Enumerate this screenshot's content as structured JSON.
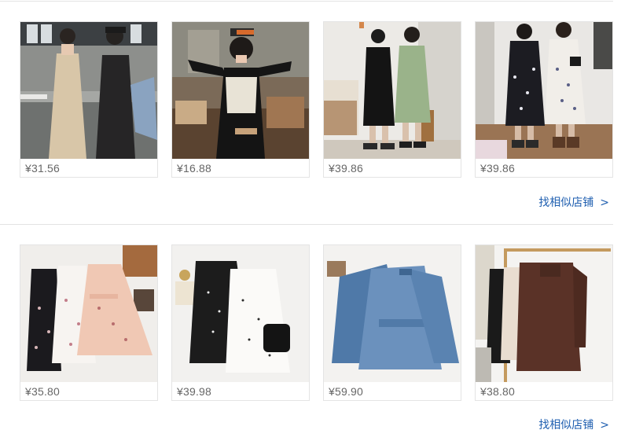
{
  "sections": [
    {
      "products": [
        {
          "price": "¥31.56",
          "image": "two-women-summer-dresses-photo"
        },
        {
          "price": "¥16.88",
          "image": "girl-knit-vest-black-dress-photo"
        },
        {
          "price": "¥39.86",
          "image": "two-women-black-and-green-dresses-photo"
        },
        {
          "price": "¥39.86",
          "image": "two-women-floral-long-dresses-photo"
        }
      ],
      "more_link": "找相似店铺",
      "more_icon": "chevron-right-icon"
    },
    {
      "products": [
        {
          "price": "¥35.80",
          "image": "floral-slip-dresses-flatlay-photo"
        },
        {
          "price": "¥39.98",
          "image": "polka-dot-dresses-flatlay-photo"
        },
        {
          "price": "¥59.90",
          "image": "denim-shirt-dresses-flatlay-photo"
        },
        {
          "price": "¥38.80",
          "image": "hoodie-dresses-on-rack-photo"
        }
      ],
      "more_link": "找相似店铺",
      "more_icon": "chevron-right-icon"
    }
  ],
  "colors": {
    "link": "#1f5fb0",
    "price_text": "#666666",
    "card_border": "#e4e4e4"
  }
}
